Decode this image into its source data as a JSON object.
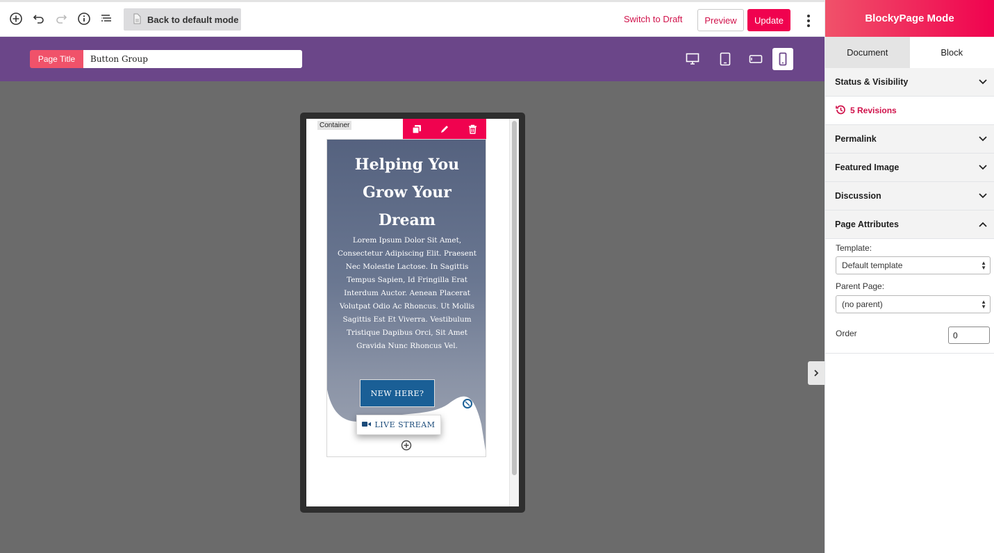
{
  "toolbar": {
    "back_label": "Back to default mode",
    "switch_draft": "Switch to Draft",
    "preview": "Preview",
    "update": "Update"
  },
  "title_bar": {
    "label": "Page Title",
    "value": "Button Group"
  },
  "canvas": {
    "container_label": "Container",
    "hero_title": "Helping You Grow Your Dream",
    "hero_body": "Lorem Ipsum Dolor Sit Amet, Consectetur Adipiscing Elit. Praesent Nec Molestie Lactose. In Sagittis Tempus Sapien, Id Fringilla Erat Interdum Auctor. Aenean Placerat Volutpat Odio Ac Rhoncus. Ut Mollis Sagittis Est Et Viverra. Vestibulum Tristique Dapibus Orci, Sit Amet Gravida Nunc Rhoncus Vel.",
    "button_primary": "NEW HERE?",
    "button_secondary": "LIVE STREAM"
  },
  "sidebar": {
    "header": "BlockyPage Mode",
    "tabs": [
      "Document",
      "Block"
    ],
    "panels": {
      "status": "Status & Visibility",
      "revisions": "5 Revisions",
      "permalink": "Permalink",
      "featured": "Featured Image",
      "discussion": "Discussion",
      "attributes": "Page Attributes"
    },
    "attributes": {
      "template_label": "Template:",
      "template_value": "Default template",
      "parent_label": "Parent Page:",
      "parent_value": "(no parent)",
      "order_label": "Order",
      "order_value": "0"
    }
  },
  "colors": {
    "accent": "#f0024f",
    "title_bar": "#6b4689",
    "canvas": "#6b6b6b",
    "button_blue": "#1a5f96"
  }
}
